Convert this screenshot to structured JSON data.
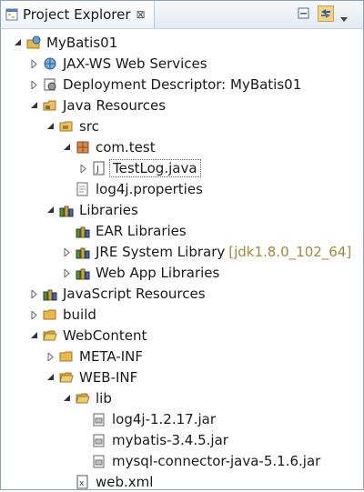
{
  "view": {
    "title": "Project Explorer",
    "close_glyph": "⊠",
    "toolbar": [
      "collapse-all-icon",
      "link-with-editor-icon"
    ]
  },
  "tree": [
    {
      "label": "MyBatis01",
      "icon": "web-project-icon",
      "state": "expanded"
    },
    {
      "label": "JAX-WS Web Services",
      "icon": "webservice-icon",
      "state": "collapsed"
    },
    {
      "label": "Deployment Descriptor: MyBatis01",
      "icon": "deployment-descriptor-icon",
      "state": "collapsed"
    },
    {
      "label": "Java Resources",
      "icon": "java-resources-icon",
      "state": "expanded"
    },
    {
      "label": "src",
      "icon": "source-folder-icon",
      "state": "expanded"
    },
    {
      "label": "com.test",
      "icon": "package-icon",
      "state": "expanded"
    },
    {
      "label": "TestLog.java",
      "icon": "java-file-icon",
      "state": "collapsed",
      "selected": true
    },
    {
      "label": "log4j.properties",
      "icon": "file-icon",
      "state": "leaf"
    },
    {
      "label": "Libraries",
      "icon": "library-icon",
      "state": "expanded"
    },
    {
      "label": "EAR Libraries",
      "icon": "library-icon",
      "state": "leaf"
    },
    {
      "label": "JRE System Library",
      "icon": "library-icon",
      "state": "collapsed",
      "decoration": "[jdk1.8.0_102_64]"
    },
    {
      "label": "Web App Libraries",
      "icon": "library-icon",
      "state": "collapsed"
    },
    {
      "label": "JavaScript Resources",
      "icon": "library-icon",
      "state": "collapsed"
    },
    {
      "label": "build",
      "icon": "folder-icon",
      "state": "collapsed"
    },
    {
      "label": "WebContent",
      "icon": "folder-open-icon",
      "state": "expanded"
    },
    {
      "label": "META-INF",
      "icon": "folder-icon",
      "state": "collapsed"
    },
    {
      "label": "WEB-INF",
      "icon": "folder-open-icon",
      "state": "expanded"
    },
    {
      "label": "lib",
      "icon": "folder-open-icon",
      "state": "expanded"
    },
    {
      "label": "log4j-1.2.17.jar",
      "icon": "jar-icon",
      "state": "leaf"
    },
    {
      "label": "mybatis-3.4.5.jar",
      "icon": "jar-icon",
      "state": "leaf"
    },
    {
      "label": "mysql-connector-java-5.1.6.jar",
      "icon": "jar-icon",
      "state": "leaf"
    },
    {
      "label": "web.xml",
      "icon": "xml-file-icon",
      "state": "leaf"
    }
  ],
  "colors": {
    "decoration": "#a08a3a",
    "folder": "#e8b84a",
    "library": "#5a8a3a"
  }
}
